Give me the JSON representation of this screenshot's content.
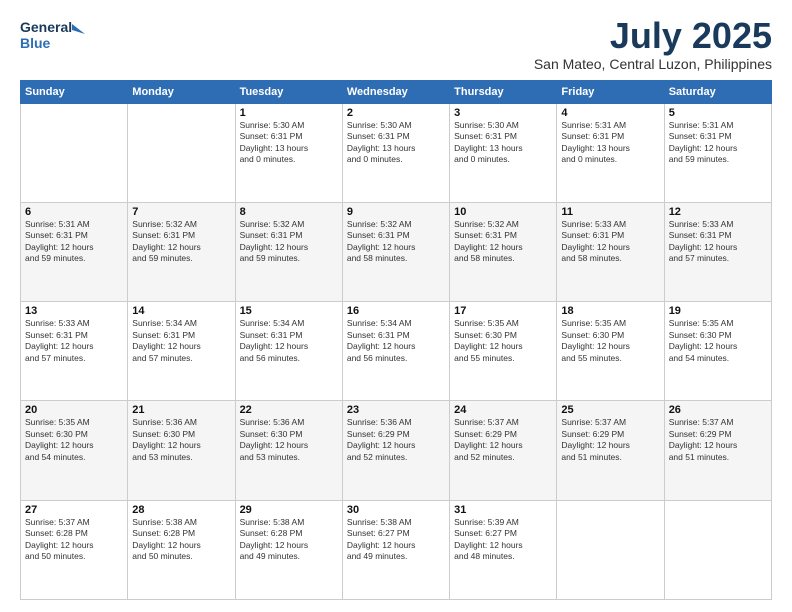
{
  "header": {
    "logo_line1": "General",
    "logo_line2": "Blue",
    "month": "July 2025",
    "location": "San Mateo, Central Luzon, Philippines"
  },
  "weekdays": [
    "Sunday",
    "Monday",
    "Tuesday",
    "Wednesday",
    "Thursday",
    "Friday",
    "Saturday"
  ],
  "weeks": [
    [
      {
        "day": "",
        "info": ""
      },
      {
        "day": "",
        "info": ""
      },
      {
        "day": "1",
        "info": "Sunrise: 5:30 AM\nSunset: 6:31 PM\nDaylight: 13 hours\nand 0 minutes."
      },
      {
        "day": "2",
        "info": "Sunrise: 5:30 AM\nSunset: 6:31 PM\nDaylight: 13 hours\nand 0 minutes."
      },
      {
        "day": "3",
        "info": "Sunrise: 5:30 AM\nSunset: 6:31 PM\nDaylight: 13 hours\nand 0 minutes."
      },
      {
        "day": "4",
        "info": "Sunrise: 5:31 AM\nSunset: 6:31 PM\nDaylight: 13 hours\nand 0 minutes."
      },
      {
        "day": "5",
        "info": "Sunrise: 5:31 AM\nSunset: 6:31 PM\nDaylight: 12 hours\nand 59 minutes."
      }
    ],
    [
      {
        "day": "6",
        "info": "Sunrise: 5:31 AM\nSunset: 6:31 PM\nDaylight: 12 hours\nand 59 minutes."
      },
      {
        "day": "7",
        "info": "Sunrise: 5:32 AM\nSunset: 6:31 PM\nDaylight: 12 hours\nand 59 minutes."
      },
      {
        "day": "8",
        "info": "Sunrise: 5:32 AM\nSunset: 6:31 PM\nDaylight: 12 hours\nand 59 minutes."
      },
      {
        "day": "9",
        "info": "Sunrise: 5:32 AM\nSunset: 6:31 PM\nDaylight: 12 hours\nand 58 minutes."
      },
      {
        "day": "10",
        "info": "Sunrise: 5:32 AM\nSunset: 6:31 PM\nDaylight: 12 hours\nand 58 minutes."
      },
      {
        "day": "11",
        "info": "Sunrise: 5:33 AM\nSunset: 6:31 PM\nDaylight: 12 hours\nand 58 minutes."
      },
      {
        "day": "12",
        "info": "Sunrise: 5:33 AM\nSunset: 6:31 PM\nDaylight: 12 hours\nand 57 minutes."
      }
    ],
    [
      {
        "day": "13",
        "info": "Sunrise: 5:33 AM\nSunset: 6:31 PM\nDaylight: 12 hours\nand 57 minutes."
      },
      {
        "day": "14",
        "info": "Sunrise: 5:34 AM\nSunset: 6:31 PM\nDaylight: 12 hours\nand 57 minutes."
      },
      {
        "day": "15",
        "info": "Sunrise: 5:34 AM\nSunset: 6:31 PM\nDaylight: 12 hours\nand 56 minutes."
      },
      {
        "day": "16",
        "info": "Sunrise: 5:34 AM\nSunset: 6:31 PM\nDaylight: 12 hours\nand 56 minutes."
      },
      {
        "day": "17",
        "info": "Sunrise: 5:35 AM\nSunset: 6:30 PM\nDaylight: 12 hours\nand 55 minutes."
      },
      {
        "day": "18",
        "info": "Sunrise: 5:35 AM\nSunset: 6:30 PM\nDaylight: 12 hours\nand 55 minutes."
      },
      {
        "day": "19",
        "info": "Sunrise: 5:35 AM\nSunset: 6:30 PM\nDaylight: 12 hours\nand 54 minutes."
      }
    ],
    [
      {
        "day": "20",
        "info": "Sunrise: 5:35 AM\nSunset: 6:30 PM\nDaylight: 12 hours\nand 54 minutes."
      },
      {
        "day": "21",
        "info": "Sunrise: 5:36 AM\nSunset: 6:30 PM\nDaylight: 12 hours\nand 53 minutes."
      },
      {
        "day": "22",
        "info": "Sunrise: 5:36 AM\nSunset: 6:30 PM\nDaylight: 12 hours\nand 53 minutes."
      },
      {
        "day": "23",
        "info": "Sunrise: 5:36 AM\nSunset: 6:29 PM\nDaylight: 12 hours\nand 52 minutes."
      },
      {
        "day": "24",
        "info": "Sunrise: 5:37 AM\nSunset: 6:29 PM\nDaylight: 12 hours\nand 52 minutes."
      },
      {
        "day": "25",
        "info": "Sunrise: 5:37 AM\nSunset: 6:29 PM\nDaylight: 12 hours\nand 51 minutes."
      },
      {
        "day": "26",
        "info": "Sunrise: 5:37 AM\nSunset: 6:29 PM\nDaylight: 12 hours\nand 51 minutes."
      }
    ],
    [
      {
        "day": "27",
        "info": "Sunrise: 5:37 AM\nSunset: 6:28 PM\nDaylight: 12 hours\nand 50 minutes."
      },
      {
        "day": "28",
        "info": "Sunrise: 5:38 AM\nSunset: 6:28 PM\nDaylight: 12 hours\nand 50 minutes."
      },
      {
        "day": "29",
        "info": "Sunrise: 5:38 AM\nSunset: 6:28 PM\nDaylight: 12 hours\nand 49 minutes."
      },
      {
        "day": "30",
        "info": "Sunrise: 5:38 AM\nSunset: 6:27 PM\nDaylight: 12 hours\nand 49 minutes."
      },
      {
        "day": "31",
        "info": "Sunrise: 5:39 AM\nSunset: 6:27 PM\nDaylight: 12 hours\nand 48 minutes."
      },
      {
        "day": "",
        "info": ""
      },
      {
        "day": "",
        "info": ""
      }
    ]
  ]
}
